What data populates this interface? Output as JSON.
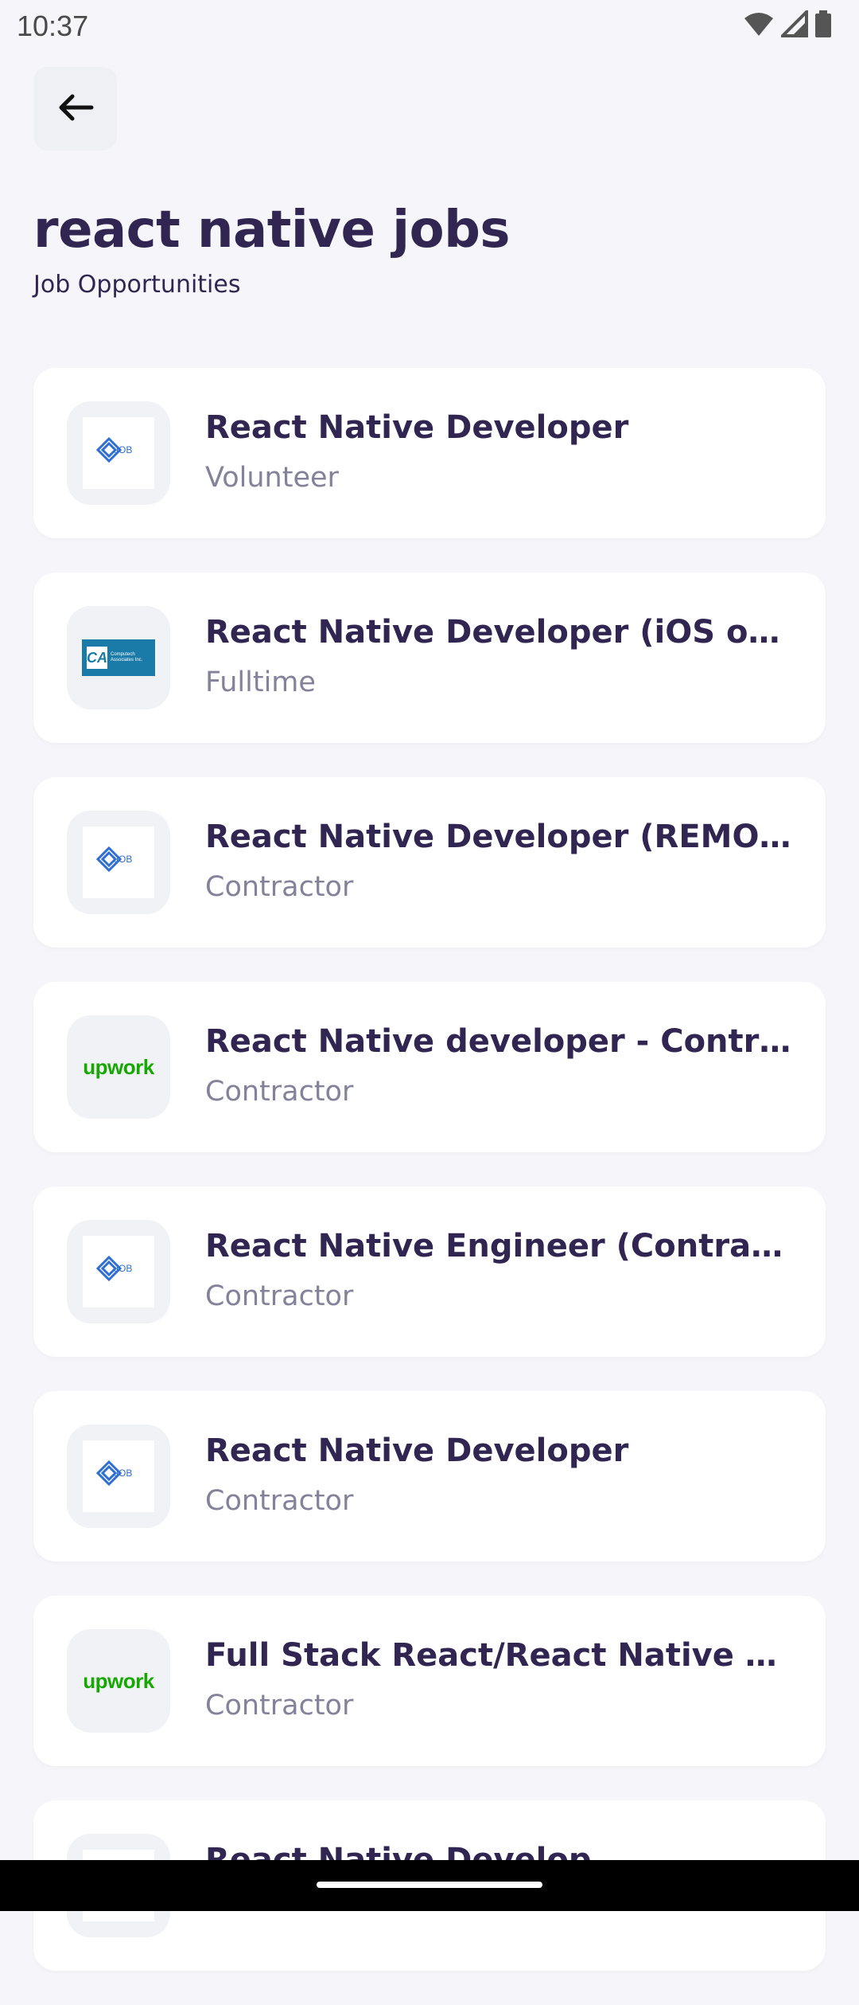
{
  "status_bar": {
    "time": "10:37"
  },
  "header": {
    "title": "react native jobs",
    "subtitle": "Job Opportunities"
  },
  "jobs": [
    {
      "title": "React Native Developer",
      "type": "Volunteer",
      "logo": "job-logo"
    },
    {
      "title": "React Native Developer (iOS or A...",
      "type": "Fulltime",
      "logo": "ca-logo"
    },
    {
      "title": "React Native Developer (REMOTE)",
      "type": "Contractor",
      "logo": "job-logo"
    },
    {
      "title": "React Native developer - Contra...",
      "type": "Contractor",
      "logo": "upwork-logo"
    },
    {
      "title": "React Native Engineer (Contract...",
      "type": "Contractor",
      "logo": "job-logo"
    },
    {
      "title": "React Native Developer",
      "type": "Contractor",
      "logo": "job-logo"
    },
    {
      "title": "Full Stack React/React Native De...",
      "type": "Contractor",
      "logo": "upwork-logo"
    },
    {
      "title": "React Native Develop...",
      "type": "",
      "logo": "job-logo"
    }
  ],
  "logos": {
    "upwork_text": "upwork",
    "job_text": "JOB",
    "ca_mark": "CA",
    "ca_text": "Computech Associates Inc."
  },
  "colors": {
    "background": "#f6f6fa",
    "title": "#312651",
    "subtitle_gray": "#83829a",
    "upwork_green": "#14a800",
    "job_blue": "#2f6fd1",
    "ca_blue": "#1a7aa8"
  }
}
